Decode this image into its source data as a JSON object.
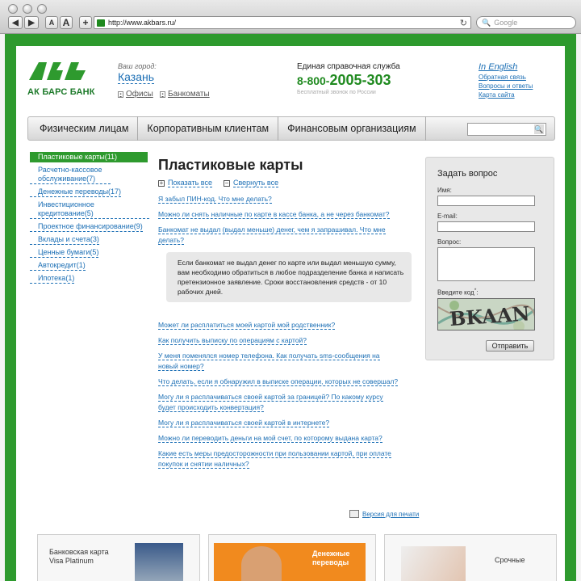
{
  "browser": {
    "back": "◀",
    "forward": "▶",
    "font_small": "A",
    "font_large": "A",
    "new_tab": "+",
    "url": "http://www.akbars.ru/",
    "reload": "↻",
    "search_placeholder": "Google"
  },
  "header": {
    "brand": "АК БАРС БАНК",
    "city_label": "Ваш город:",
    "city": "Казань",
    "offices": "Офисы",
    "atms": "Банкоматы",
    "hotline_label": "Единая справочная служба",
    "hotline_prefix": "8-800-",
    "hotline_number": "2005-303",
    "hotline_note": "Бесплатный звонок по России",
    "english": "In English",
    "links": [
      "Обратная связь",
      "Вопросы и ответы",
      "Карта сайта"
    ]
  },
  "nav": {
    "items": [
      "Физическим лицам",
      "Корпоративным клиентам",
      "Финансовым организациям"
    ],
    "search_icon": "🔍"
  },
  "sidebar": {
    "items": [
      {
        "label": "Пластиковые карты(11)",
        "active": true
      },
      {
        "label": "Расчетно-кассовое обслуживание(7)"
      },
      {
        "label": "Денежные переводы(17)"
      },
      {
        "label": "Инвестиционное кредитование(5)"
      },
      {
        "label": "Проектное финансирование(9)"
      },
      {
        "label": "Вклады и счета(3)"
      },
      {
        "label": "Ценные бумаги(5)"
      },
      {
        "label": "Автокредит(1)"
      },
      {
        "label": "Ипотека(1)"
      }
    ]
  },
  "main": {
    "title": "Пластиковые карты",
    "show_all": "Показать все",
    "collapse_all": "Свернуть все",
    "questions_top": [
      "Я забыл ПИН-код. Что мне делать?",
      "Можно ли снять наличные по карте в кассе банка, а не через банкомат?",
      "Банкомат не выдал (выдал меньше) денег, чем я запрашивал. Что мне делать?"
    ],
    "answer": "Если банкомат не выдал денег по карте или выдал меньшую сумму, вам необходимо обратиться в любое подразделение  банка и написать претензионное заявление. Сроки восстановления средств - от 10 рабочих дней.",
    "questions_bottom": [
      "Может ли расплатиться моей картой мой родственник?",
      "Как получить выписку по операциям с картой?",
      "У меня поменялся номер телефона. Как получать sms-сообщения на новый номер?",
      "Что делать, если я обнаружил в выписке операции, которых не совершал?",
      "Могу ли я расплачиваться своей картой за границей? По какому курсу будет происходить конвертация?",
      "Могу ли я расплачиваться своей картой в интернете?",
      "Можно ли переводить деньги на мой счет, по которому выдана карта?",
      "Какие есть меры предосторожности при пользовании картой, при оплате покупок и снятии наличных?"
    ],
    "print": "Версия для печати"
  },
  "ask": {
    "title": "Задать вопрос",
    "name_label": "Имя:",
    "email_label": "E-mail:",
    "question_label": "Вопрос:",
    "code_label": "Введите код",
    "code_star": "*",
    "code_colon": ":",
    "captcha_text": "BKAAN",
    "submit": "Отправить"
  },
  "promos": [
    {
      "text": "Банковская карта Visa Platinum"
    },
    {
      "text": "Денежные переводы"
    },
    {
      "text": "Срочные"
    }
  ],
  "colors": {
    "brand_green": "#2e9a2e",
    "link_blue": "#1c6fb5"
  }
}
